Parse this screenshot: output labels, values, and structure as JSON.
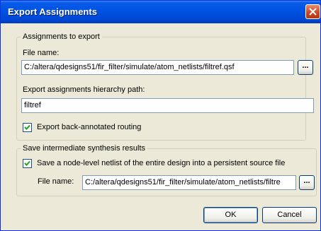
{
  "window": {
    "title": "Export Assignments"
  },
  "assignments": {
    "legend": "Assignments to export",
    "file_name_label": "File name:",
    "file_name_value": "C:/altera/qdesigns51/fir_filter/simulate/atom_netlists/filtref.qsf",
    "browse_label": "...",
    "hierarchy_label": "Export assignments hierarchy path:",
    "hierarchy_value": "filtref",
    "back_annotated_label": "Export back-annotated routing",
    "back_annotated_checked": true
  },
  "synthesis": {
    "legend": "Save intermediate synthesis results",
    "save_netlist_label": "Save a node-level netlist of the entire design into a persistent source file",
    "save_netlist_checked": true,
    "file_name_label": "File name:",
    "file_name_value": "C:/altera/qdesigns51/fir_filter/simulate/atom_netlists/filtre",
    "browse_label": "..."
  },
  "buttons": {
    "ok": "OK",
    "cancel": "Cancel"
  }
}
